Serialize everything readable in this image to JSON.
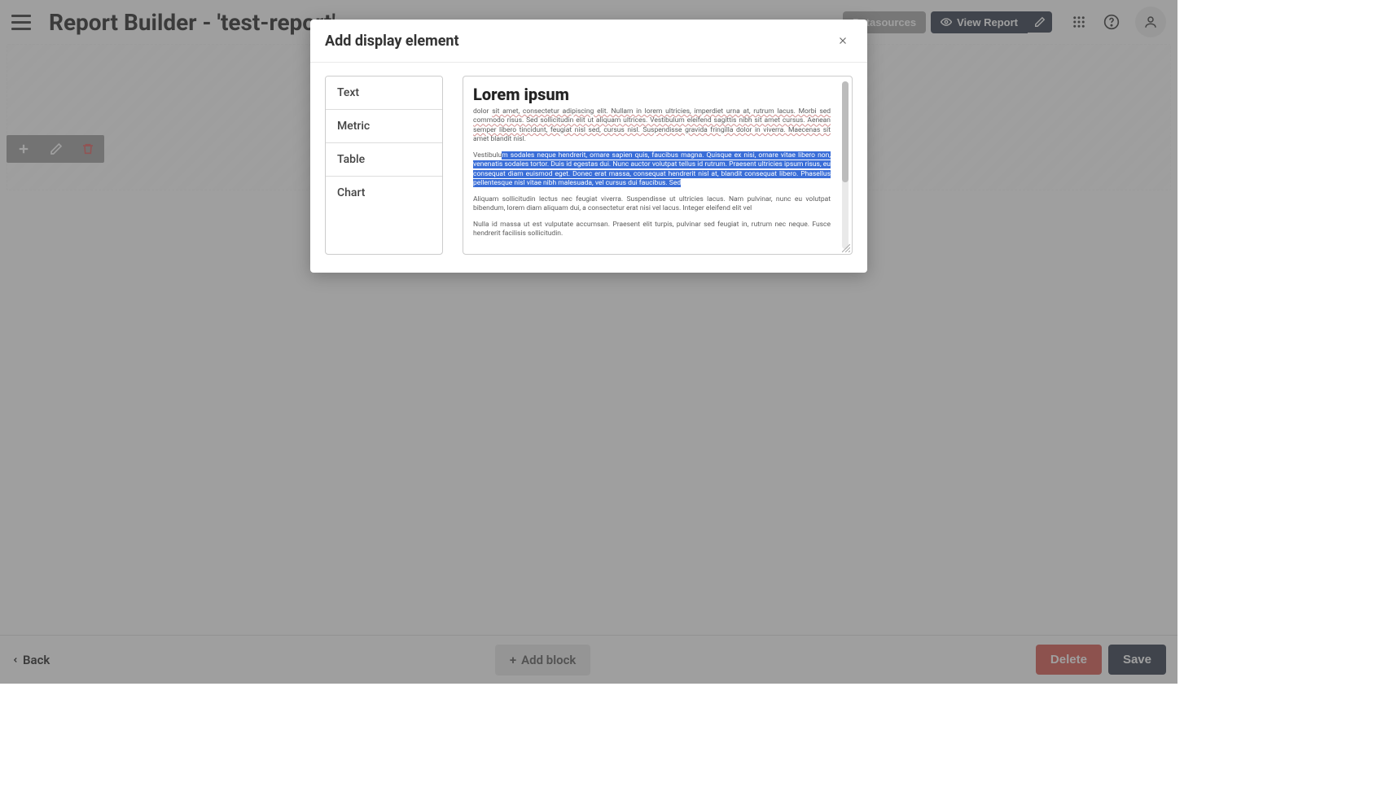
{
  "header": {
    "title": "Report Builder - 'test-report'",
    "datasources_label": "Datasources",
    "view_report_label": "View Report"
  },
  "footer": {
    "back_label": "Back",
    "add_block_label": "Add block",
    "delete_label": "Delete",
    "save_label": "Save"
  },
  "modal": {
    "title": "Add display element",
    "types": [
      {
        "label": "Text"
      },
      {
        "label": "Metric"
      },
      {
        "label": "Table"
      },
      {
        "label": "Chart"
      }
    ],
    "preview": {
      "heading": "Lorem ipsum",
      "para1_plain_start": "dolor ",
      "para1_wavy": "sit amet, consectetur adipiscing elit. Nullam in lorem ultricies, imperdiet urna at, rutrum lacus. Morbi sed commodo risus. Sed sollicitudin elit ut aliquam ultrices. Vestibulum eleifend sagittis nibh sit amet cursus. Aenean semper libero tincidunt, feugiat nisl sed, cursus nisl. Suspendisse gravida fringilla dolor in viverra. Maecenas sit",
      "para1_plain_end": " amet blandit nisl.",
      "para2_plain_start": "Vestibulu",
      "para2_selected": "m sodales neque hendrerit, ornare sapien quis, faucibus magna. Quisque ex nisi, ornare vitae libero non, venenatis sodales tortor. Duis id egestas dui. Nunc auctor volutpat tellus id rutrum. Praesent ultricies ipsum risus, eu consequat diam euismod eget. Donec erat massa, consequat hendrerit nisl at, blandit consequat libero. Phasellus pellentesque nisl vitae nibh malesuada, vel cursus dui faucibus. Sed",
      "para3": "Aliquam sollicitudin lectus nec feugiat viverra. Suspendisse ut ultricies lacus. Nam pulvinar, nunc eu volutpat bibendum, lorem diam aliquam dui, a consectetur erat nisi vel lacus. Integer eleifend elit vel",
      "para4": "Nulla id massa ut est vulputate accumsan. Praesent elit turpis, pulvinar sed feugiat in, rutrum nec neque. Fusce hendrerit facilisis sollicitudin."
    }
  }
}
